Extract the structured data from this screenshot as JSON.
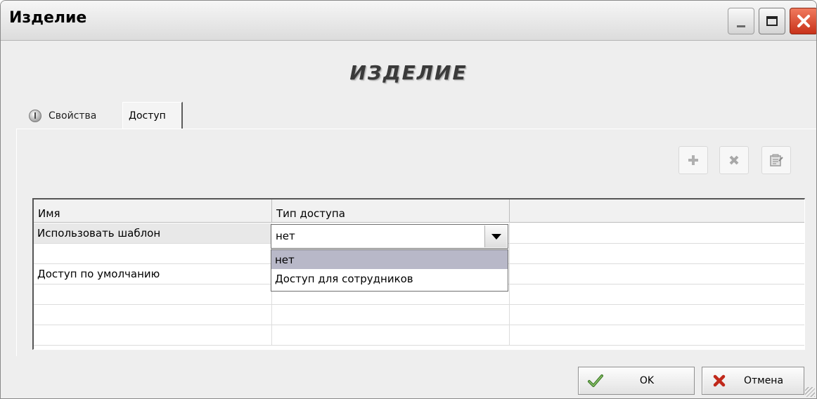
{
  "window": {
    "title": "Изделие",
    "heading": "ИЗДЕЛИЕ"
  },
  "tabs": [
    {
      "label": "Свойства",
      "icon": "info-icon",
      "active": false
    },
    {
      "label": "Доступ",
      "active": true
    }
  ],
  "toolbar": {
    "add_icon": "plus-icon",
    "delete_icon": "x-icon",
    "properties_icon": "properties-icon"
  },
  "grid": {
    "columns": [
      "Имя",
      "Тип доступа",
      ""
    ],
    "rows": [
      {
        "name": "Использовать шаблон",
        "access": "нет"
      },
      {
        "name": "",
        "access": ""
      },
      {
        "name": "Доступ по умолчанию",
        "access": ""
      },
      {
        "name": "",
        "access": ""
      },
      {
        "name": "",
        "access": ""
      },
      {
        "name": "",
        "access": ""
      }
    ]
  },
  "combo": {
    "value": "нет",
    "options": [
      "нет",
      "Доступ для сотрудников"
    ],
    "highlighted_index": 0
  },
  "buttons": {
    "ok": "OK",
    "cancel": "Отмена"
  },
  "colors": {
    "window_bg": "#eeeeee",
    "close_button": "#d9452a",
    "dropdown_highlight": "#b8b8c8",
    "ok_icon": "#2f6b1f",
    "cancel_icon": "#c0281a"
  }
}
